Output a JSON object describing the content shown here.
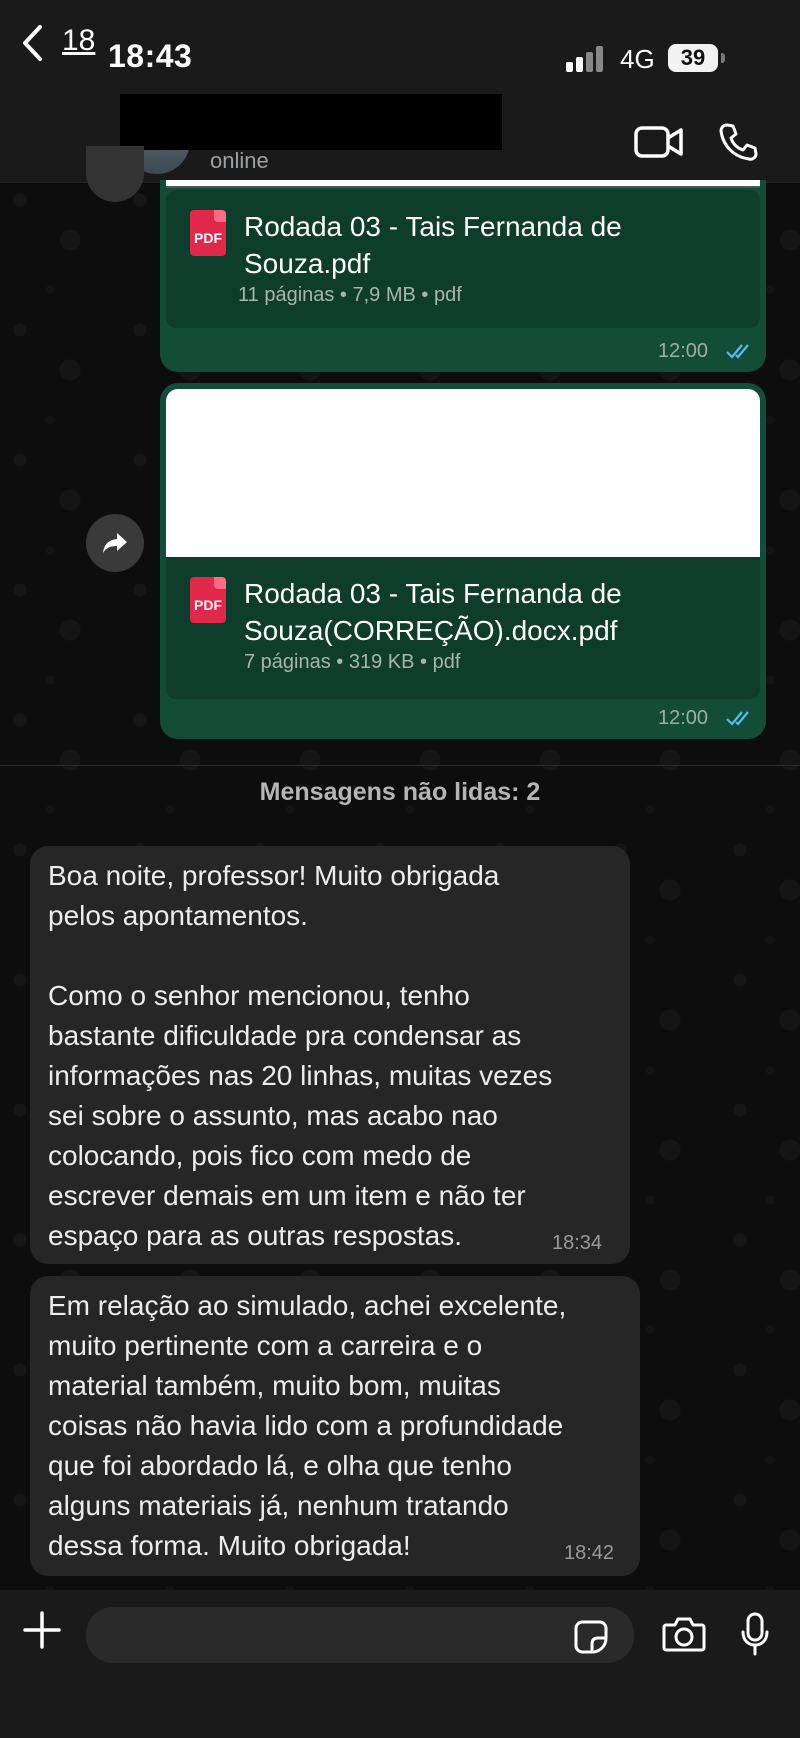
{
  "status_bar": {
    "time": "18:43",
    "network": "4G",
    "battery": "39"
  },
  "header": {
    "back_count": "18",
    "contact_status": "online"
  },
  "messages_out": [
    {
      "file_name": "Rodada 03 - Tais Fernanda de Souza.pdf",
      "meta": "11 páginas • 7,9 MB • pdf",
      "time": "12:00",
      "icon_label": "PDF"
    },
    {
      "file_name": "Rodada 03 - Tais Fernanda de Souza(CORREÇÃO).docx.pdf",
      "meta": "7 páginas • 319 KB • pdf",
      "time": "12:00",
      "icon_label": "PDF"
    }
  ],
  "unread_label": "Mensagens não lidas: 2",
  "messages_in": [
    {
      "text": "Boa noite, professor! Muito obrigada\npelos apontamentos.\n\nComo o senhor mencionou, tenho\nbastante dificuldade pra condensar as\ninformações nas 20 linhas, muitas vezes\nsei sobre o assunto, mas acabo nao\ncolocando, pois fico com medo de\nescrever demais em um item e não ter\nespaço para as outras respostas.",
      "time": "18:34"
    },
    {
      "text": "Em relação ao simulado, achei excelente,\nmuito pertinente com a carreira e o\nmaterial também, muito bom, muitas\ncoisas não havia lido com a profundidade\nque foi abordado lá, e olha que tenho\nalguns materiais já, nenhum tratando\ndessa forma. Muito obrigada!",
      "time": "18:42"
    }
  ],
  "colors": {
    "outgoing_bubble": "#144d37",
    "incoming_bubble": "#262626",
    "read_ticks": "#53bdeb",
    "pdf_icon": "#e0294a"
  }
}
